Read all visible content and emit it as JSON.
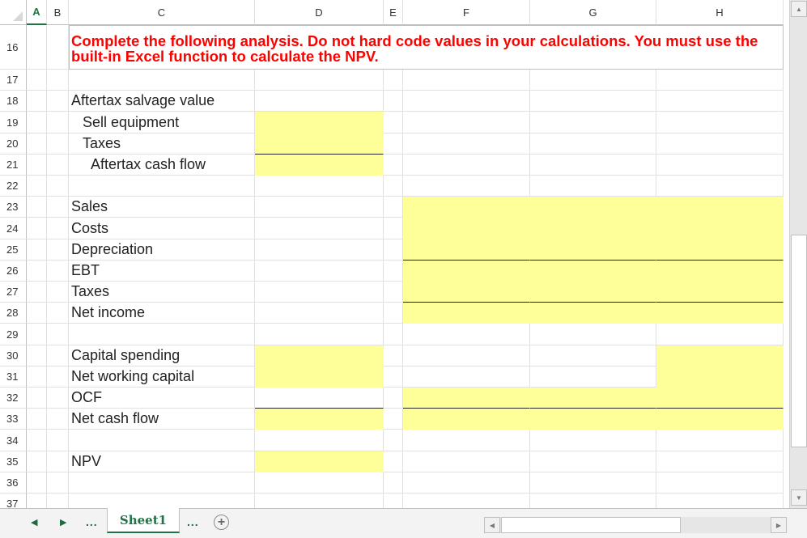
{
  "columns": [
    "A",
    "B",
    "C",
    "D",
    "E",
    "F",
    "G",
    "H"
  ],
  "active_column": "A",
  "instruction_row": {
    "row": "16",
    "text": "Complete the following analysis. Do not hard code values in your calculations. You must use the built-in Excel function to calculate the NPV.",
    "color": "#ff0000"
  },
  "rows": [
    {
      "num": "17",
      "label": ""
    },
    {
      "num": "18",
      "label": "Aftertax salvage value"
    },
    {
      "num": "19",
      "label": "Sell equipment"
    },
    {
      "num": "20",
      "label": "Taxes"
    },
    {
      "num": "21",
      "label": "Aftertax cash flow"
    },
    {
      "num": "22",
      "label": ""
    },
    {
      "num": "23",
      "label": "Sales"
    },
    {
      "num": "24",
      "label": "Costs"
    },
    {
      "num": "25",
      "label": "Depreciation"
    },
    {
      "num": "26",
      "label": "EBT"
    },
    {
      "num": "27",
      "label": "Taxes"
    },
    {
      "num": "28",
      "label": "Net income"
    },
    {
      "num": "29",
      "label": ""
    },
    {
      "num": "30",
      "label": "Capital spending"
    },
    {
      "num": "31",
      "label": "Net working capital"
    },
    {
      "num": "32",
      "label": "OCF"
    },
    {
      "num": "33",
      "label": "Net cash flow"
    },
    {
      "num": "34",
      "label": ""
    },
    {
      "num": "35",
      "label": "NPV"
    },
    {
      "num": "36",
      "label": ""
    },
    {
      "num": "37",
      "label": ""
    }
  ],
  "input_fill_color": "#ffff99",
  "sheet_tabs": {
    "active": "Sheet1",
    "prev_label": "◀",
    "next_label": "▶",
    "more_left": "...",
    "more_right": "...",
    "add_label": "+"
  }
}
